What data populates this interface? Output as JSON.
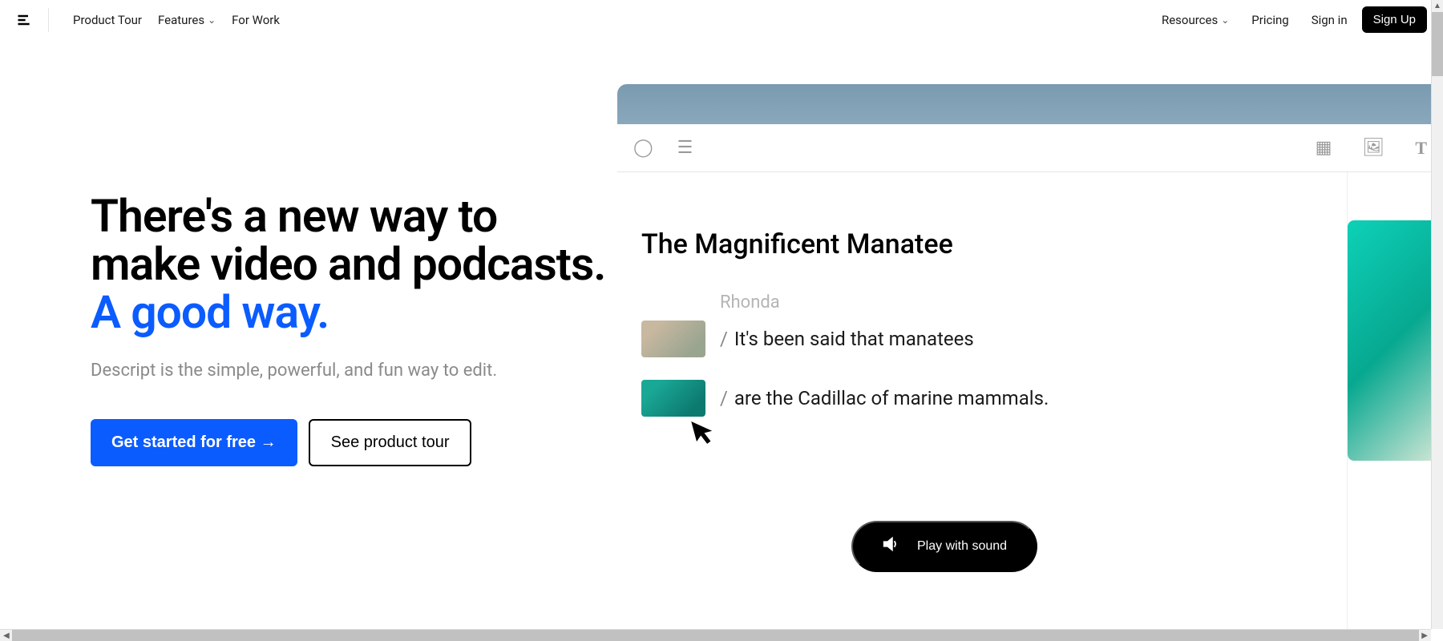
{
  "nav": {
    "product_tour": "Product Tour",
    "features": "Features",
    "for_work": "For Work",
    "resources": "Resources",
    "pricing": "Pricing",
    "sign_in": "Sign in",
    "sign_up": "Sign Up"
  },
  "hero": {
    "headline_part1": "There's a new way to make video and podcasts. ",
    "headline_accent": "A good way.",
    "subheading": "Descript is the simple, powerful, and fun way to edit.",
    "cta_primary": "Get started for free →",
    "cta_secondary": "See product tour"
  },
  "preview": {
    "title": "The Magnificent Manatee",
    "speaker": "Rhonda",
    "line1": "It's been said that manatees",
    "line2": "are the Cadillac of marine mammals."
  },
  "sound_pill": "Play with sound"
}
